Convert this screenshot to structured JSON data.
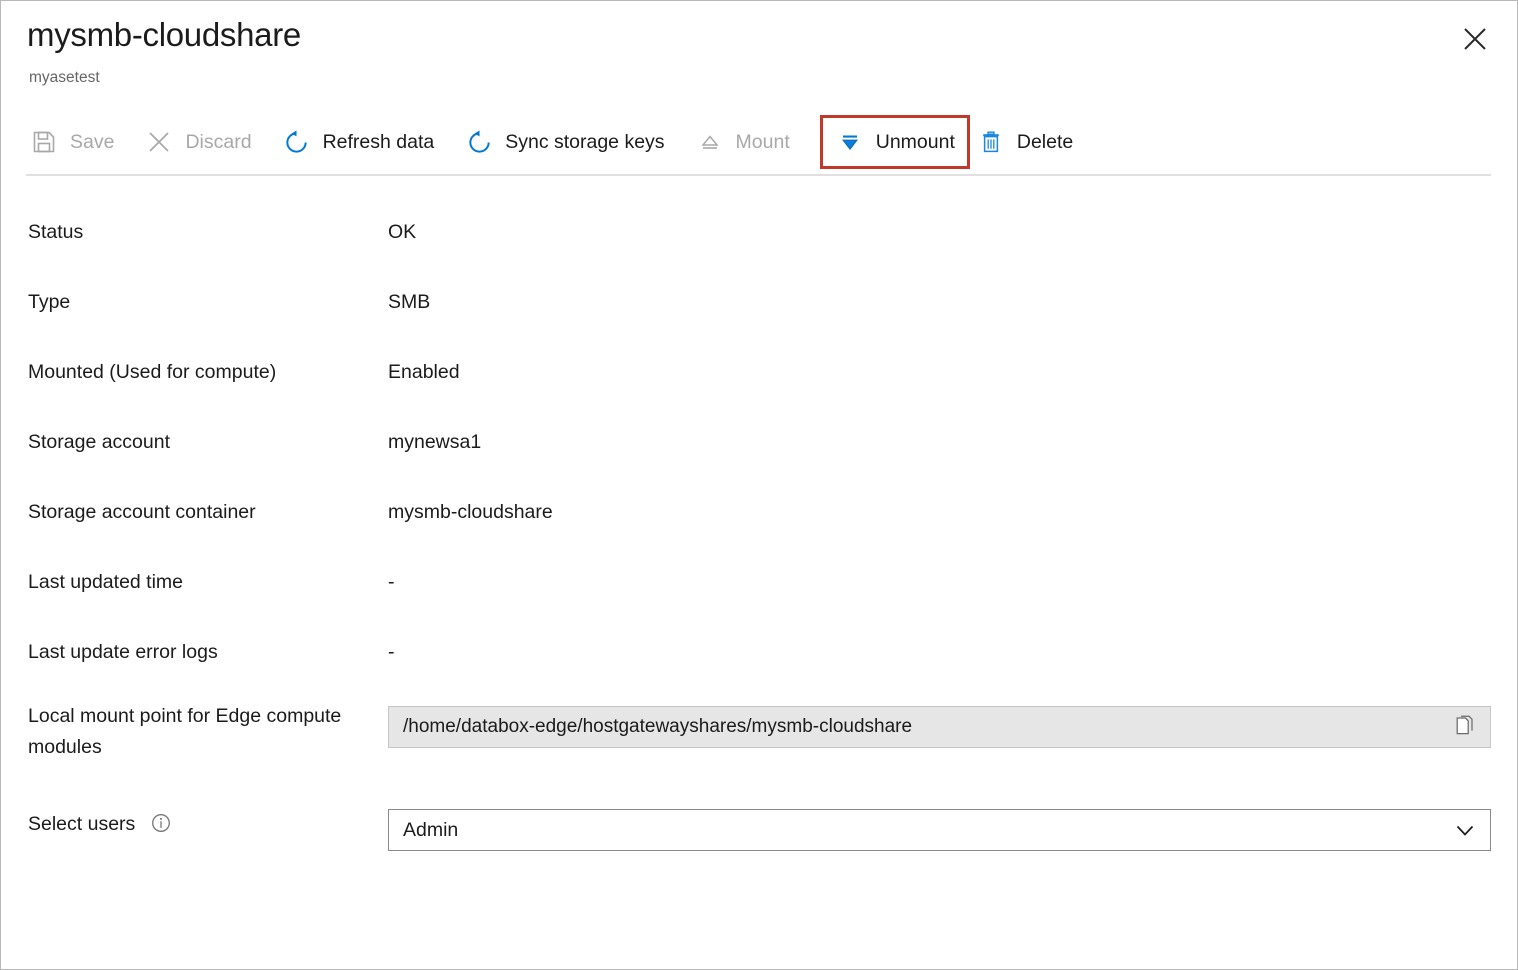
{
  "header": {
    "title": "mysmb-cloudshare",
    "subtitle": "myasetest",
    "close_label": "Close"
  },
  "toolbar": {
    "items": [
      {
        "label": "Save",
        "icon": "save-icon",
        "enabled": false,
        "highlighted": false
      },
      {
        "label": "Discard",
        "icon": "discard-icon",
        "enabled": false,
        "highlighted": false
      },
      {
        "label": "Refresh data",
        "icon": "refresh-icon",
        "enabled": true,
        "highlighted": false
      },
      {
        "label": "Sync storage keys",
        "icon": "sync-icon",
        "enabled": true,
        "highlighted": false
      },
      {
        "label": "Mount",
        "icon": "mount-eject-icon",
        "enabled": false,
        "highlighted": false
      },
      {
        "label": "Unmount",
        "icon": "unmount-icon",
        "enabled": true,
        "highlighted": true
      },
      {
        "label": "Delete",
        "icon": "trash-icon",
        "enabled": true,
        "highlighted": false
      }
    ]
  },
  "properties": {
    "status": {
      "label": "Status",
      "value": "OK"
    },
    "type": {
      "label": "Type",
      "value": "SMB"
    },
    "mounted": {
      "label": "Mounted (Used for compute)",
      "value": "Enabled"
    },
    "storage_account": {
      "label": "Storage account",
      "value": "mynewsa1"
    },
    "storage_container": {
      "label": "Storage account container",
      "value": "mysmb-cloudshare"
    },
    "last_updated_time": {
      "label": "Last updated time",
      "value": "-"
    },
    "last_update_error": {
      "label": "Last update error logs",
      "value": "-"
    },
    "local_mount_point": {
      "label": "Local mount point for Edge compute modules",
      "value": "/home/databox-edge/hostgatewayshares/mysmb-cloudshare"
    },
    "select_users": {
      "label": "Select users",
      "value": "Admin"
    }
  },
  "colors": {
    "accent_blue": "#0078d4",
    "highlight_red": "#c0392b",
    "disabled_grey": "#a8a8a8",
    "text_primary": "#1b1b1b",
    "field_readonly_bg": "#e6e6e6"
  }
}
